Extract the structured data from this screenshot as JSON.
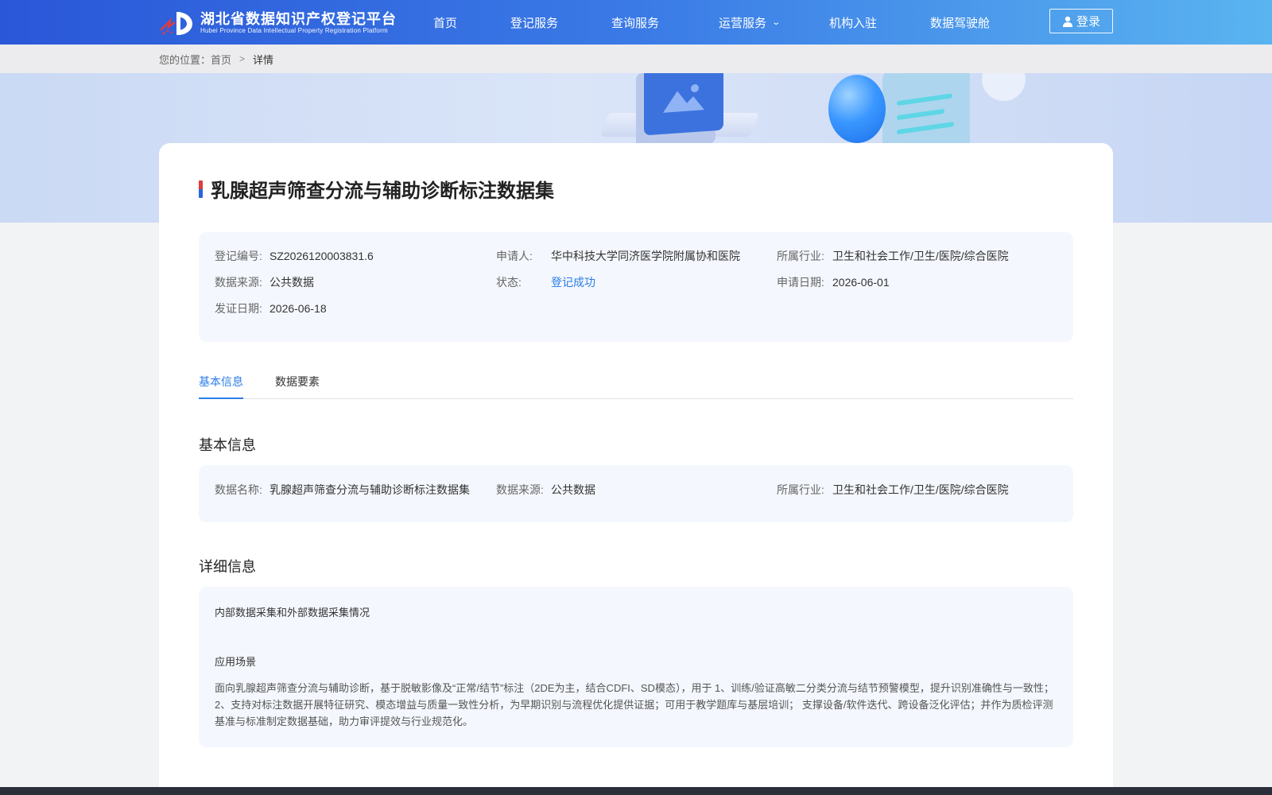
{
  "header": {
    "logo_title": "湖北省数据知识产权登记平台",
    "logo_subtitle": "Hubei Province Data Intellectual Property Registration Platform",
    "nav": [
      {
        "label": "首页"
      },
      {
        "label": "登记服务"
      },
      {
        "label": "查询服务"
      },
      {
        "label": "运营服务"
      },
      {
        "label": "机构入驻"
      },
      {
        "label": "数据驾驶舱"
      }
    ],
    "login_label": "登录"
  },
  "breadcrumb": {
    "prefix": "您的位置：",
    "home": "首页",
    "current": "详情"
  },
  "record": {
    "title": "乳腺超声筛查分流与辅助诊断标注数据集",
    "summary": {
      "reg_no_label": "登记编号:",
      "reg_no": "SZ2026120003831.6",
      "applicant_label": "申请人:",
      "applicant": "华中科技大学同济医学院附属协和医院",
      "industry_label": "所属行业:",
      "industry": "卫生和社会工作/卫生/医院/综合医院",
      "source_label": "数据来源:",
      "source": "公共数据",
      "status_label": "状态:",
      "status": "登记成功",
      "apply_date_label": "申请日期:",
      "apply_date": "2026-06-01",
      "issue_date_label": "发证日期:",
      "issue_date": "2026-06-18"
    }
  },
  "tabs": [
    {
      "label": "基本信息"
    },
    {
      "label": "数据要素"
    }
  ],
  "basic_info": {
    "heading": "基本信息",
    "name_label": "数据名称:",
    "name": "乳腺超声筛查分流与辅助诊断标注数据集",
    "source_label": "数据来源:",
    "source": "公共数据",
    "industry_label": "所属行业:",
    "industry": "卫生和社会工作/卫生/医院/综合医院"
  },
  "detail_info": {
    "heading": "详细信息",
    "collection_title": "内部数据采集和外部数据采集情况",
    "scenario_title": "应用场景",
    "scenario_text": "面向乳腺超声筛查分流与辅助诊断，基于脱敏影像及“正常/结节”标注（2DE为主，结合CDFI、SD模态），用于 1、训练/验证高敏二分类分流与结节预警模型，提升识别准确性与一致性； 2、支持对标注数据开展特征研究、模态增益与质量一致性分析，为早期识别与流程优化提供证据；可用于教学题库与基层培训； 支撑设备/软件迭代、跨设备泛化评估；并作为质检评测基准与标准制定数据基础，助力审评提效与行业规范化。"
  },
  "colors": {
    "accent": "#2b7de8",
    "header_start": "#2a57d8",
    "header_end": "#5ab4f0",
    "panel_bg": "#f4f7fd"
  }
}
